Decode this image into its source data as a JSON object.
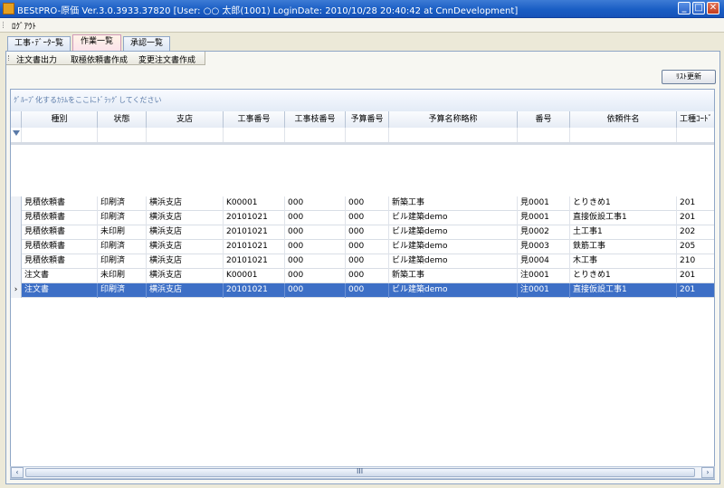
{
  "window": {
    "title": "BEStPRO-原価 Ver.3.0.3933.37820  [User: ○○  太郎(1001)  LoginDate: 2010/10/28 20:40:42 at CnnDevelopment]",
    "minimize": "_",
    "maximize": "□",
    "close": "✕"
  },
  "menu": {
    "logout": "ﾛｸﾞｱｳﾄ"
  },
  "tabs": [
    {
      "label": "工事･ﾃﾞｰﾀｰ覧"
    },
    {
      "label": "作業一覧"
    },
    {
      "label": "承認一覧"
    }
  ],
  "toolbar": {
    "items": [
      {
        "label": "注文書出力"
      },
      {
        "label": "取極依頼書作成"
      },
      {
        "label": "変更注文書作成"
      }
    ],
    "refresh": "ﾘｽﾄ更新"
  },
  "grid": {
    "group_hint": "ｸﾞﾙｰﾌﾟ化するｶﾗﾑをここにﾄﾞﾗｯｸﾞしてください",
    "columns": [
      "種別",
      "状態",
      "支店",
      "工事番号",
      "工事枝番号",
      "予算番号",
      "予算名称略称",
      "番号",
      "依頼件名",
      "工種ｺｰﾄﾞ"
    ],
    "rows": [
      [
        "見積依頼書",
        "印刷済",
        "横浜支店",
        "K00001",
        "000",
        "000",
        "新築工事",
        "見0001",
        "とりきめ1",
        "201"
      ],
      [
        "見積依頼書",
        "印刷済",
        "横浜支店",
        "20101021",
        "000",
        "000",
        "ビル建築demo",
        "見0001",
        "直接仮設工事1",
        "201"
      ],
      [
        "見積依頼書",
        "未印刷",
        "横浜支店",
        "20101021",
        "000",
        "000",
        "ビル建築demo",
        "見0002",
        "土工事1",
        "202"
      ],
      [
        "見積依頼書",
        "印刷済",
        "横浜支店",
        "20101021",
        "000",
        "000",
        "ビル建築demo",
        "見0003",
        "鉄筋工事",
        "205"
      ],
      [
        "見積依頼書",
        "印刷済",
        "横浜支店",
        "20101021",
        "000",
        "000",
        "ビル建築demo",
        "見0004",
        "木工事",
        "210"
      ],
      [
        "注文書",
        "未印刷",
        "横浜支店",
        "K00001",
        "000",
        "000",
        "新築工事",
        "注0001",
        "とりきめ1",
        "201"
      ],
      [
        "注文書",
        "印刷済",
        "横浜支店",
        "20101021",
        "000",
        "000",
        "ビル建築demo",
        "注0001",
        "直接仮設工事1",
        "201"
      ]
    ],
    "selected_row": 6,
    "row_indicator": "›"
  },
  "scrollbar": {
    "left": "‹",
    "right": "›",
    "grip": "III"
  },
  "colors": {
    "selection": "#3d6fc6",
    "titlebar": "#1a5ec4"
  }
}
